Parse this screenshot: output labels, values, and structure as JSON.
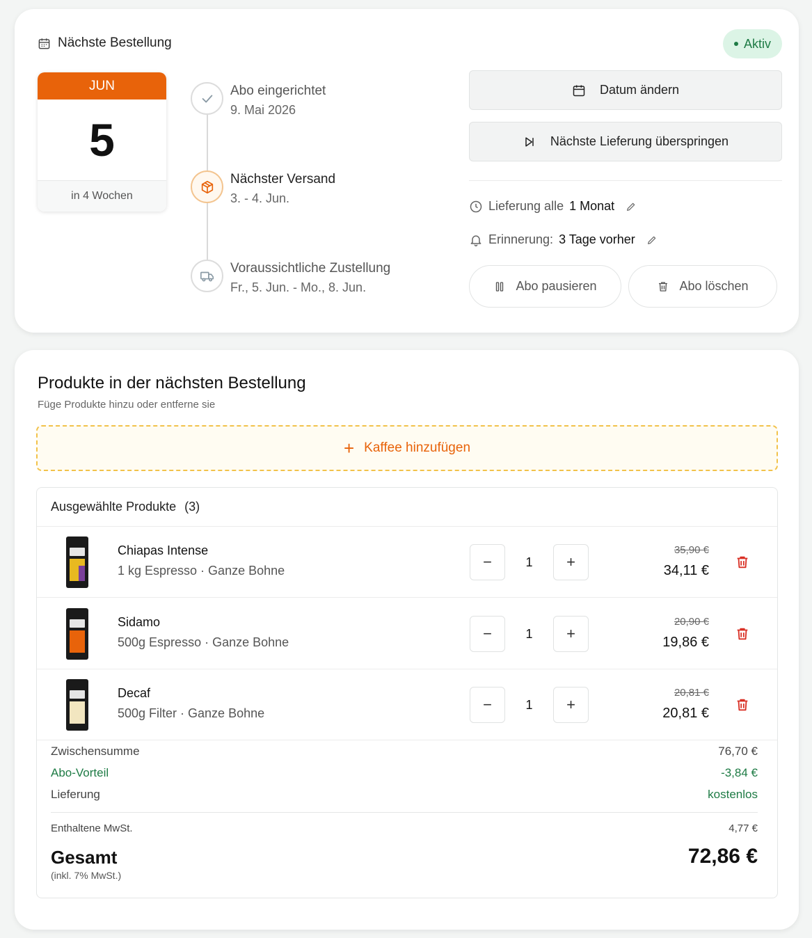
{
  "order": {
    "header_title": "Nächste Bestellung",
    "status": "Aktiv",
    "calendar": {
      "month": "JUN",
      "day": "5",
      "relative": "in 4 Wochen"
    },
    "timeline": [
      {
        "title": "Abo eingerichtet",
        "subtitle": "9. Mai 2026",
        "icon": "check-icon"
      },
      {
        "title": "Nächster Versand",
        "subtitle": "3. - 4. Jun.",
        "icon": "package-icon"
      },
      {
        "title": "Voraussichtliche Zustellung",
        "subtitle": "Fr., 5. Jun. - Mo., 8. Jun.",
        "icon": "truck-icon"
      }
    ],
    "change_date_label": "Datum ändern",
    "skip_label": "Nächste Lieferung überspringen",
    "frequency_label": "Lieferung alle",
    "frequency_value": "1 Monat",
    "reminder_label": "Erinnerung:",
    "reminder_value": "3 Tage vorher",
    "pause_label": "Abo pausieren",
    "delete_label": "Abo löschen"
  },
  "products": {
    "title": "Produkte in der nächsten Bestellung",
    "subtitle": "Füge Produkte hinzu oder entferne sie",
    "add_label": "Kaffee hinzufügen",
    "selected_label": "Ausgewählte Produkte",
    "selected_count": "(3)",
    "items": [
      {
        "name": "Chiapas Intense",
        "desc": "1 kg Espresso · Ganze Bohne",
        "qty": "1",
        "old_price": "35,90 €",
        "price": "34,11 €",
        "label_color": "#e8b920"
      },
      {
        "name": "Sidamo",
        "desc": "500g Espresso · Ganze Bohne",
        "qty": "1",
        "old_price": "20,90 €",
        "price": "19,86 €",
        "label_color": "#e8630a"
      },
      {
        "name": "Decaf",
        "desc": "500g Filter · Ganze Bohne",
        "qty": "1",
        "old_price": "20,81 €",
        "price": "20,81 €",
        "label_color": "#f2e6c0"
      }
    ],
    "minus": "−",
    "plus": "+"
  },
  "totals": {
    "subtotal_label": "Zwischensumme",
    "subtotal_value": "76,70 €",
    "discount_label": "Abo-Vorteil",
    "discount_value": "-3,84 €",
    "delivery_label": "Lieferung",
    "delivery_value": "kostenlos",
    "vat_label": "Enthaltene MwSt.",
    "vat_value": "4,77 €",
    "total_label": "Gesamt",
    "total_value": "72,86 €",
    "total_note": "(inkl. 7% MwSt.)"
  },
  "colors": {
    "accent": "#e8630a",
    "success": "#1e7b45",
    "danger": "#d93025"
  }
}
